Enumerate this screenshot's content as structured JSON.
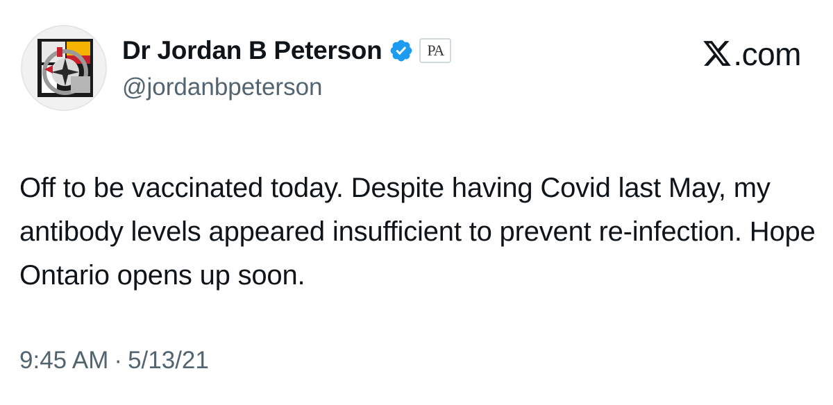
{
  "author": {
    "display_name": "Dr Jordan B Peterson",
    "handle": "@jordanbpeterson",
    "verified_icon": "verified-check-icon",
    "verified_color": "#1d9bf0",
    "affiliation_badge": "PA"
  },
  "site": {
    "label": ".com",
    "logo_icon": "x-logo-icon"
  },
  "tweet": {
    "text": "Off to be vaccinated today. Despite having Covid last May, my antibody levels appeared insufficient to prevent re-infection. Hope Ontario opens up soon.",
    "time": "9:45 AM",
    "separator": "·",
    "date": "5/13/21"
  },
  "colors": {
    "text_primary": "#0f1419",
    "text_secondary": "#536471",
    "background": "#ffffff"
  }
}
